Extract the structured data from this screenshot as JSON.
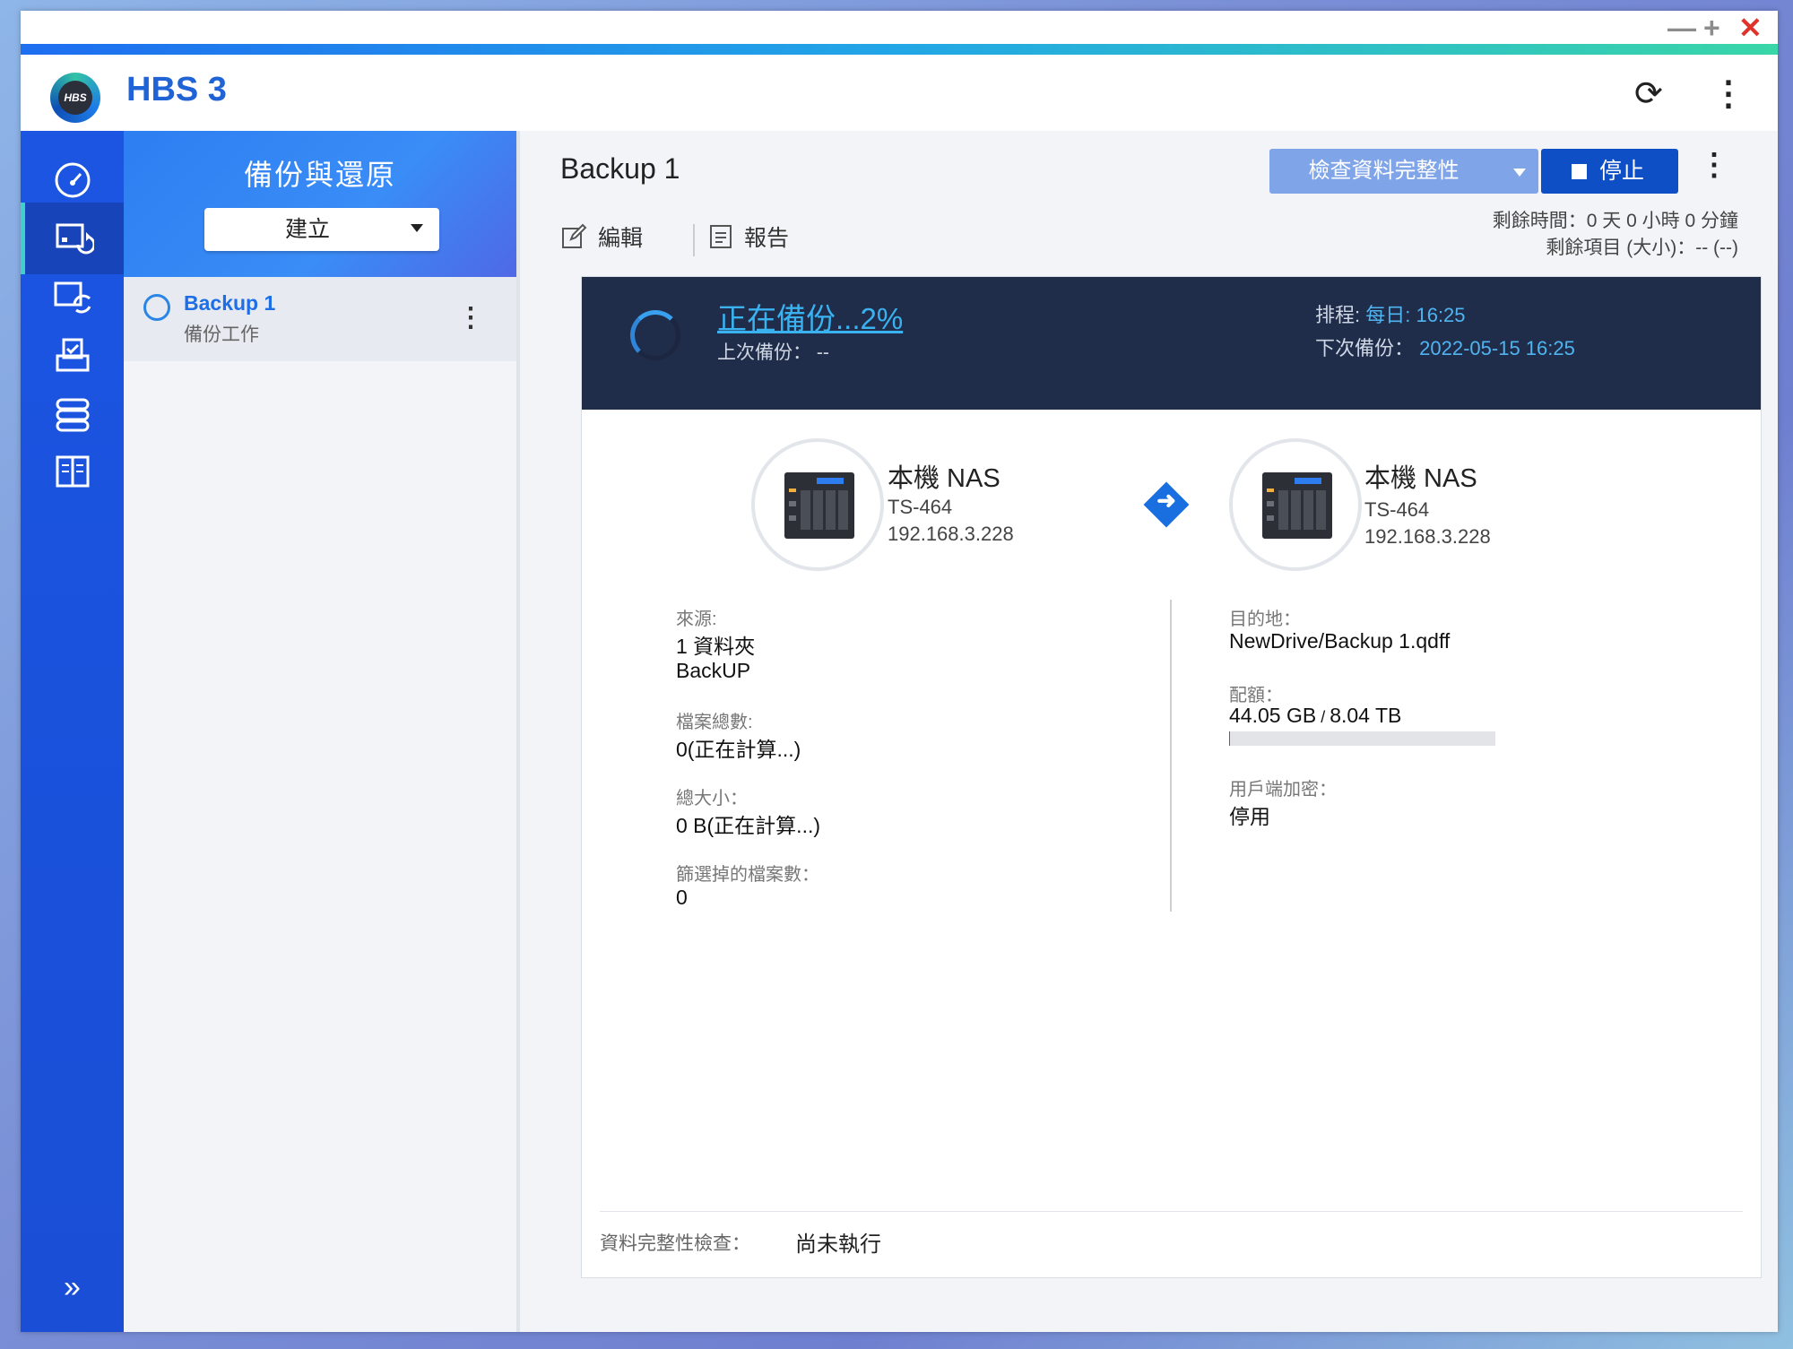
{
  "window": {
    "minimize": "—",
    "maximize": "+",
    "close": "✕"
  },
  "header": {
    "app_name": "HBS 3",
    "logo_text": "HBS"
  },
  "rail": {
    "items": [
      "overview-icon",
      "backup-restore-icon",
      "sync-icon",
      "services-icon",
      "storage-icon",
      "logs-icon"
    ],
    "active_index": 1,
    "expand": "»"
  },
  "sidebar": {
    "title": "備份與還原",
    "create_label": "建立",
    "jobs": [
      {
        "name": "Backup 1",
        "subtitle": "備份工作"
      }
    ]
  },
  "main": {
    "title": "Backup 1",
    "check_integrity_label": "檢查資料完整性",
    "stop_label": "停止",
    "edit_label": "編輯",
    "report_label": "報告",
    "remaining_time": "剩餘時間：0 天 0 小時 0 分鐘",
    "remaining_items": "剩餘項目 (大小)：-- (--)"
  },
  "banner": {
    "status": "正在備份...2%",
    "last_backup": "上次備份： --",
    "schedule_label": "排程:",
    "schedule_value": "每日: 16:25",
    "next_label": "下次備份：",
    "next_value": "2022-05-15 16:25"
  },
  "source_nas": {
    "name": "本機 NAS",
    "model": "TS-464",
    "ip": "192.168.3.228"
  },
  "dest_nas": {
    "name": "本機 NAS",
    "model": "TS-464",
    "ip": "192.168.3.228"
  },
  "source": {
    "label": "來源:",
    "folders": "1 資料夾",
    "folder_name": "BackUP",
    "total_files_label": "檔案總數:",
    "total_files_value": "0(正在計算...)",
    "total_size_label": "總大小：",
    "total_size_value": "0 B(正在計算...)",
    "filtered_label": "篩選掉的檔案數：",
    "filtered_value": "0"
  },
  "destination": {
    "label": "目的地：",
    "path": "NewDrive/Backup 1.qdff",
    "quota_label": "配額：",
    "quota_used": "44.05 GB",
    "quota_sep": " / ",
    "quota_total": "8.04 TB",
    "quota_fraction": 0.005,
    "encryption_label": "用戶端加密：",
    "encryption_value": "停用"
  },
  "footer": {
    "integrity_label": "資料完整性檢查：",
    "integrity_value": "尚未執行"
  },
  "colors": {
    "accent": "#1f63d6",
    "rail": "#1b55e2",
    "banner": "#1f2d4a",
    "stop": "#0f4fc6",
    "link": "#3ab2f0"
  }
}
